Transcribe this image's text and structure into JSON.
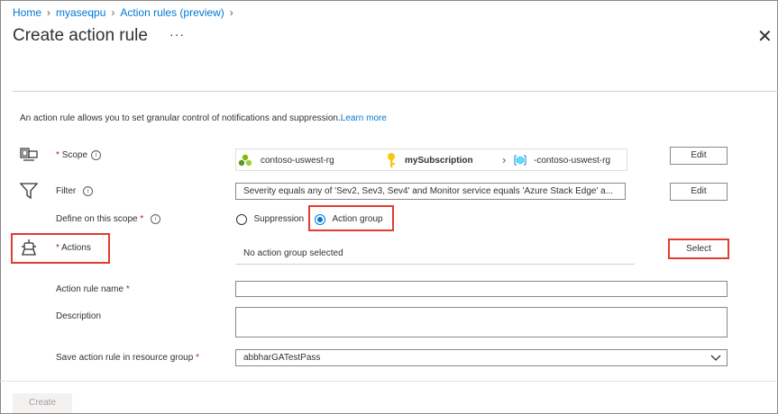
{
  "breadcrumb": {
    "items": [
      "Home",
      "myaseqpu",
      "Action rules (preview)"
    ]
  },
  "page": {
    "title": "Create action rule",
    "more": "···",
    "close": "✕"
  },
  "intro": {
    "text": "An action rule allows you to set granular control of notifications and suppression.",
    "link": "Learn more"
  },
  "scope": {
    "label": "Scope",
    "required": "*",
    "resource_group": "contoso-uswest-rg",
    "subscription": "mySubscription",
    "resource": "-contoso-uswest-rg",
    "edit_label": "Edit"
  },
  "filter": {
    "label": "Filter",
    "value": "Severity equals any of 'Sev2, Sev3, Sev4' and Monitor service equals 'Azure Stack Edge' a...",
    "edit_label": "Edit"
  },
  "define_scope": {
    "label": "Define on this scope",
    "required": "*",
    "options": [
      "Suppression",
      "Action group"
    ],
    "selected": "Action group"
  },
  "actions": {
    "label": "Actions",
    "required": "*",
    "status": "No action group selected",
    "select_label": "Select"
  },
  "rule_name": {
    "label": "Action rule name",
    "required": "*",
    "value": ""
  },
  "description": {
    "label": "Description",
    "value": ""
  },
  "resource_group": {
    "label": "Save action rule in resource group",
    "required": "*",
    "selected": "abbharGATestPass"
  },
  "footer": {
    "create_label": "Create"
  },
  "colors": {
    "accent": "#0078d4",
    "highlight": "#e03c31",
    "required": "#a4262c"
  },
  "icons": [
    "scope-icon",
    "filter-icon",
    "actions-icon",
    "info-icon",
    "resource-group-icon",
    "key-icon",
    "resource-icon",
    "chevron-right-icon",
    "chevron-down-icon"
  ]
}
